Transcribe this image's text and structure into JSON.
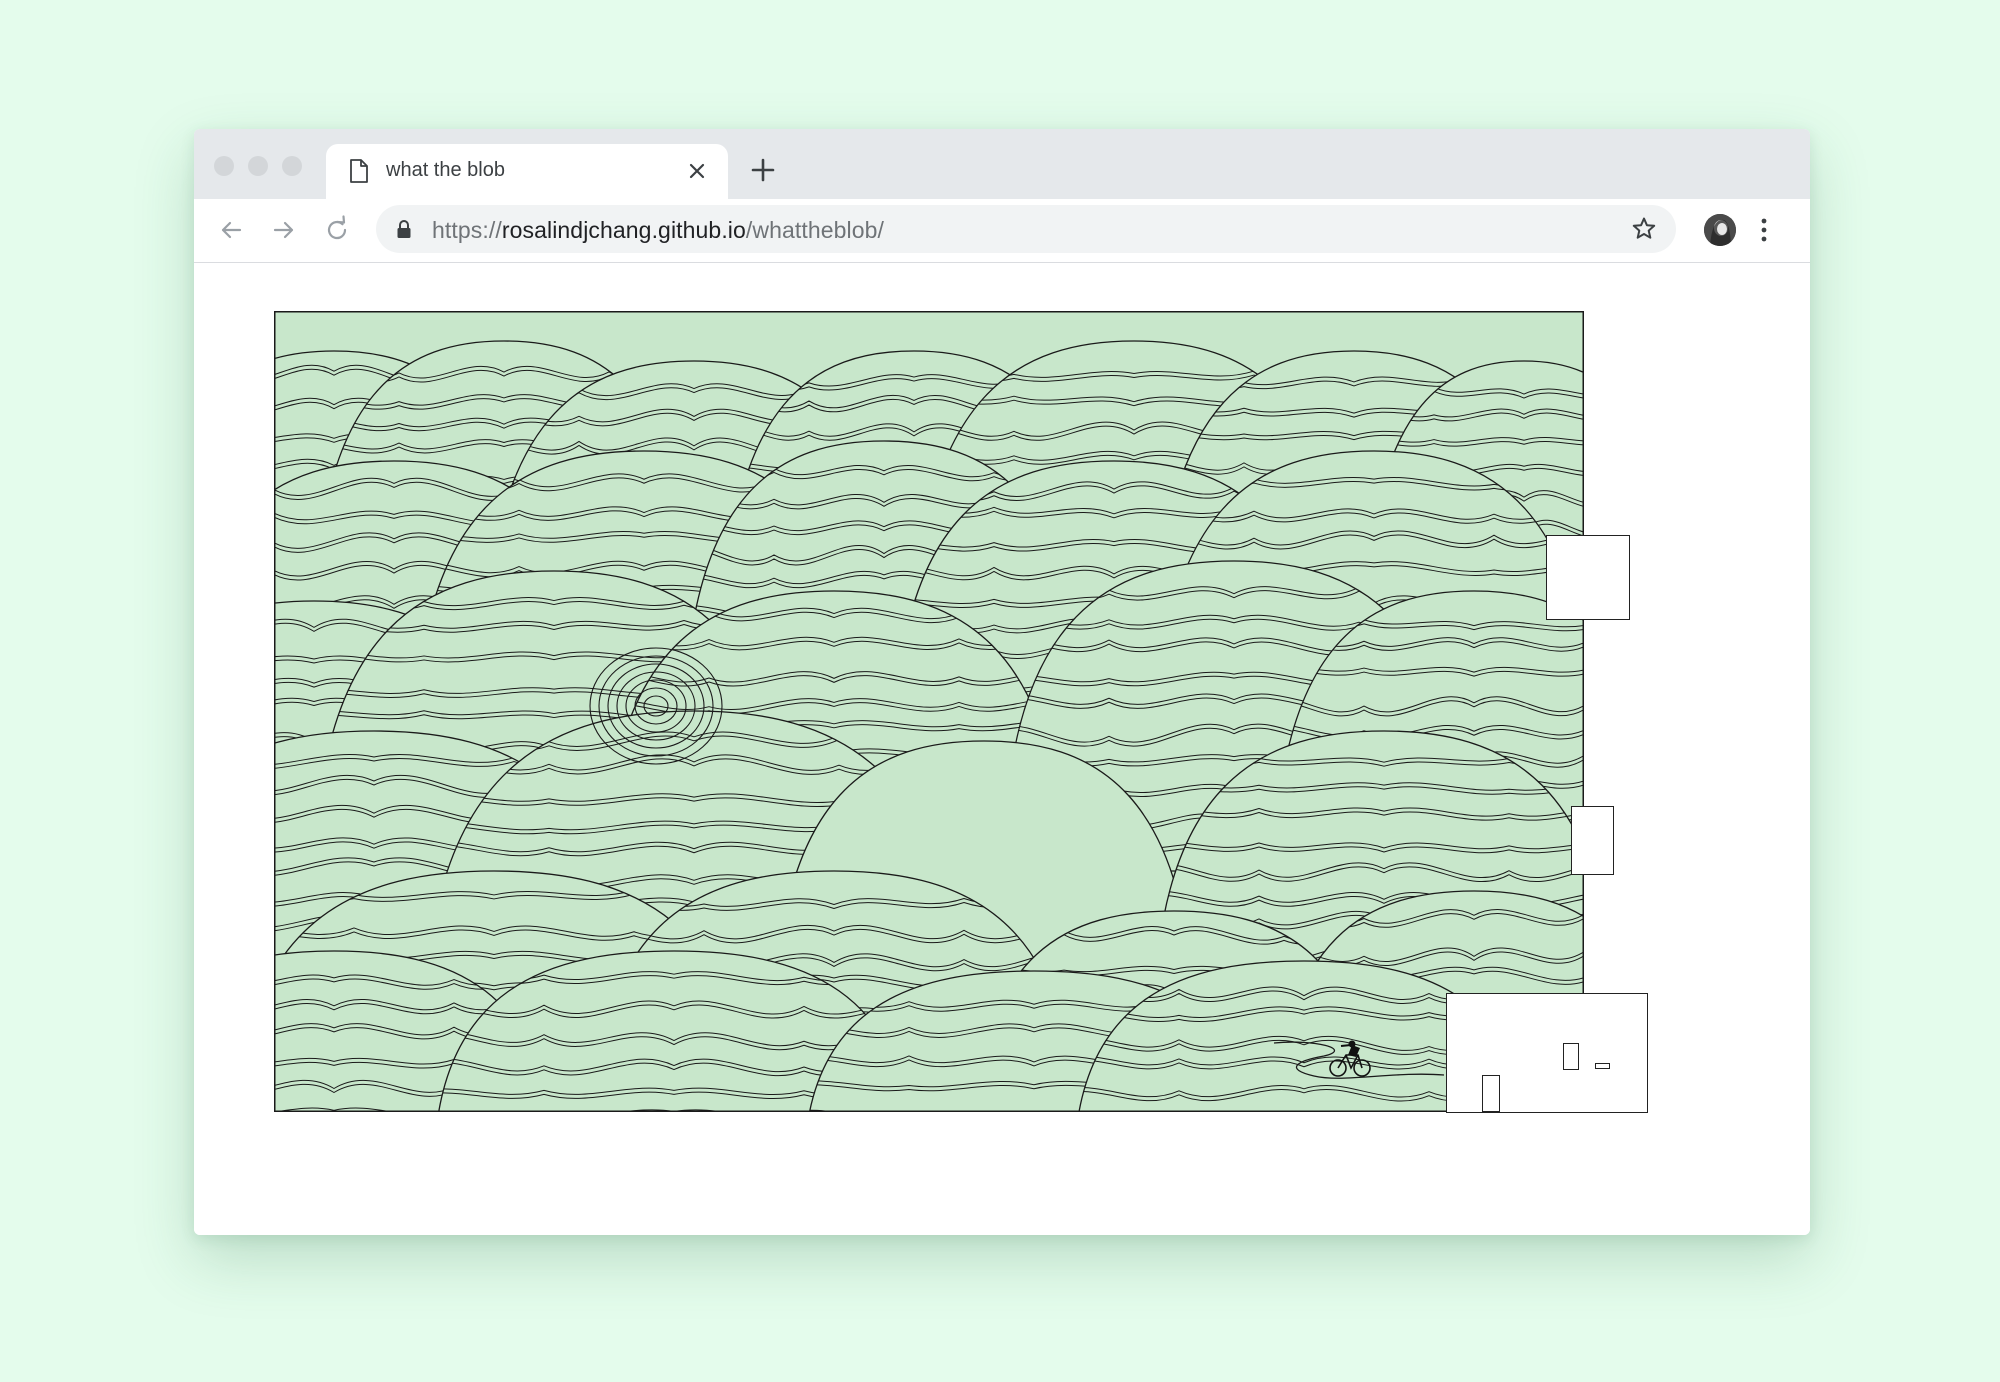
{
  "browser": {
    "tab": {
      "title": "what the blob",
      "icon": "document-icon"
    },
    "address_bar": {
      "scheme": "https://",
      "host": "rosalindjchang.github.io",
      "path": "/whattheblob/"
    },
    "icons": [
      "back-arrow-icon",
      "forward-arrow-icon",
      "reload-icon",
      "lock-icon",
      "bookmark-star-icon",
      "more-menu-icon",
      "close-icon",
      "plus-icon"
    ]
  },
  "colors": {
    "page_background": "#e4fcec",
    "canvas_fill": "#c8e7cb",
    "line": "#1a1a1a",
    "tabstrip": "#e5e8eb",
    "omnibox": "#f1f3f4"
  }
}
